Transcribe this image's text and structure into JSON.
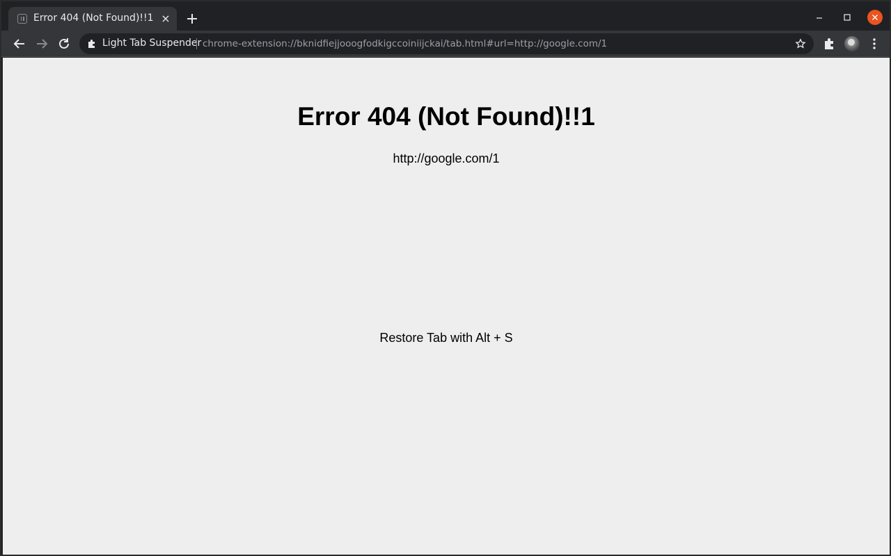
{
  "tab": {
    "title": "Error 404 (Not Found)!!1",
    "favicon": "pause-icon",
    "close": "×"
  },
  "toolbar": {
    "origin_label": "Light Tab Suspender",
    "url": "chrome-extension://bknidfiejjooogfodkigccoiniijckai/tab.html#url=http://google.com/1"
  },
  "page": {
    "heading": "Error 404 (Not Found)!!1",
    "url_text": "http://google.com/1",
    "restore_hint": "Restore Tab with Alt + S"
  },
  "colors": {
    "background": "#eeeeee",
    "chrome_dark": "#202124",
    "chrome_toolbar": "#35363a",
    "close_accent": "#e95420"
  }
}
